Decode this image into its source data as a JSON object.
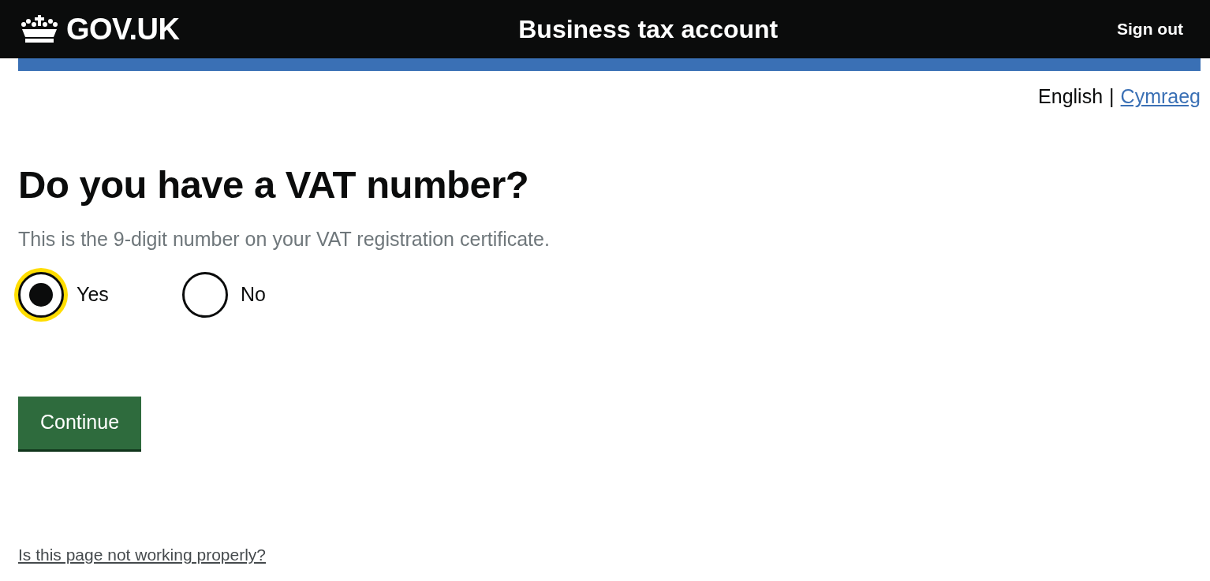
{
  "header": {
    "logo": "GOV.UK",
    "service_name": "Business tax account",
    "sign_out": "Sign out"
  },
  "language_switcher": {
    "separator": "|",
    "languages": [
      {
        "label": "English",
        "selected": true
      },
      {
        "label": "Cymraeg",
        "selected": false
      }
    ]
  },
  "question": {
    "heading": "Do you have a VAT number?",
    "hint": "This is the 9-digit number on your VAT registration certificate.",
    "options": [
      {
        "label": "Yes",
        "selected": true,
        "focused": true
      },
      {
        "label": "No",
        "selected": false,
        "focused": false
      }
    ]
  },
  "continue_button": "Continue",
  "report_link": "Is this page not working properly?"
}
